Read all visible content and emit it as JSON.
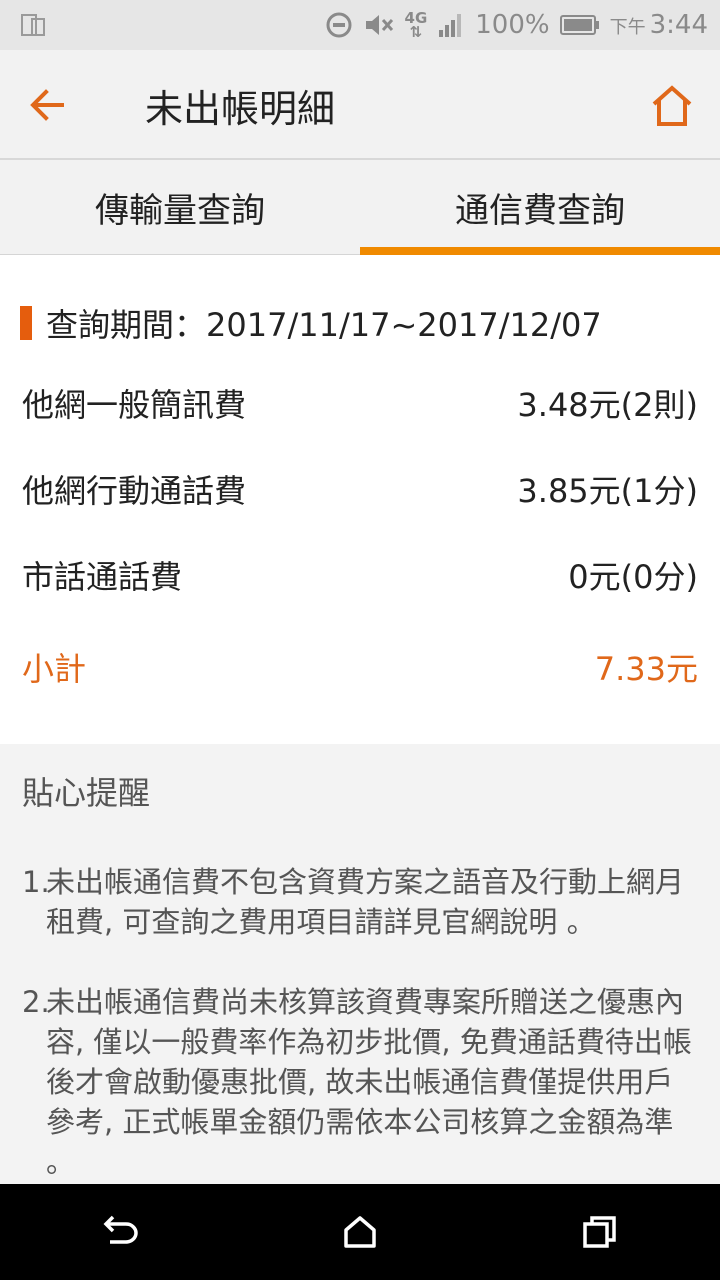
{
  "status_bar": {
    "battery_percent": "100%",
    "ampm": "下午",
    "time": "3:44",
    "network_label": "4G",
    "icons": [
      "screen-mirror-icon",
      "do-not-disturb-icon",
      "mute-icon",
      "4g-data-icon",
      "signal-icon",
      "battery-icon"
    ]
  },
  "app_bar": {
    "title": "未出帳明細",
    "back_icon": "back-arrow-icon",
    "home_icon": "home-icon"
  },
  "tabs": [
    {
      "label": "傳輸量查詢",
      "active": false
    },
    {
      "label": "通信費查詢",
      "active": true
    }
  ],
  "period": {
    "text": "查詢期間：2017/11/17~2017/12/07"
  },
  "fees": [
    {
      "name": "他網一般簡訊費",
      "value": "3.48元(2則)"
    },
    {
      "name": "他網行動通話費",
      "value": "3.85元(1分)"
    },
    {
      "name": "市話通話費",
      "value": "0元(0分)"
    }
  ],
  "subtotal": {
    "label": "小計",
    "value": "7.33元"
  },
  "reminder": {
    "title": "貼心提醒",
    "notes": [
      {
        "num": "1.",
        "text": "未出帳通信費不包含資費方案之語音及行動上網月租費, 可查詢之費用項目請詳見官網說明 。"
      },
      {
        "num": "2.",
        "text": "未出帳通信費尚未核算該資費專案所贈送之優惠內容, 僅以一般費率作為初步批價, 免費通話費待出帳後才會啟動優惠批價, 故未出帳通信費僅提供用戶參考, 正式帳單金額仍需依本公司核算之金額為準 。"
      }
    ]
  },
  "colors": {
    "accent": "#f08a00",
    "highlight": "#e0681a",
    "period_marker": "#e55d0d"
  },
  "nav_bar": {
    "icons": [
      "back-nav-icon",
      "home-nav-icon",
      "recents-nav-icon"
    ]
  }
}
